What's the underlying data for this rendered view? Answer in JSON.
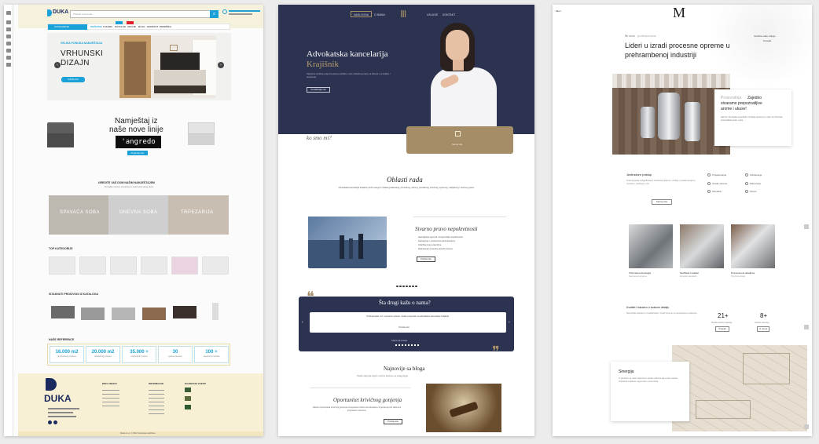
{
  "duka": {
    "logo": "DUKA",
    "search_placeholder": "Pretraži proizvode...",
    "nav": {
      "categories": "KATEGORIJE",
      "items": [
        "POČETNA",
        "O NAMA",
        "KATALOG",
        "AKCIJE",
        "BLOG",
        "KONTAKT",
        "PODRŠKA"
      ]
    },
    "hero": {
      "kicker": "VELIKA PONUDA NAMJEŠTAJA",
      "title1": "VRHUNSKI",
      "title2": "DIZAJN",
      "button": "KATALOG"
    },
    "promo": {
      "line1": "Namještaj iz",
      "line2": "naše nove linije",
      "brand": "'angredo",
      "button": "Pogledaj više"
    },
    "rooms": {
      "title": "UREDITE VAŠ DOM NAŠIM NAMJEŠTAJEM",
      "subtitle": "Pronađite savršen namještaj za svaki kutak vašeg doma",
      "labels": [
        "SPAVAĆA SOBA",
        "DNEVNA SOBA",
        "TRPEZARIJA"
      ]
    },
    "top_categories": "TOP KATEGORIJE",
    "featured": "ISTAKNUTI PROIZVODI IZ KATALOGA",
    "references": {
      "title": "NAŠE REFERENCE",
      "stats": [
        {
          "value": "16.000 m2",
          "label": "proizvodnog prostora"
        },
        {
          "value": "20.000 m2",
          "label": "skladišnog prostora"
        },
        {
          "value": "35.000 +",
          "label": "zadovoljnih kupaca"
        },
        {
          "value": "30",
          "label": "godina iskustva"
        },
        {
          "value": "100 +",
          "label": "zaposlenih radnika"
        }
      ]
    },
    "footer": {
      "col1": "BRZI LINKOVI",
      "col2": "INFORMACIJE",
      "col3": "NAJNOVIJE VIJESTI",
      "copyright": "Duka d.o.o. © 2021 Sva prava zadržana"
    }
  },
  "law": {
    "nav": [
      "NASLOVNA",
      "O NAMA",
      "USLUGE",
      "KONTAKT"
    ],
    "hero": {
      "title": "Advokatska kancelarija",
      "name": "Krajišnik",
      "text": "Klijentima pružamo potpunu pravnu podršku u svim oblastima prava, sa fokusom na kvalitet i povjerenje.",
      "button": "Kontaktirajte nas"
    },
    "about_fragment": "ko smo mi?",
    "gold_text": "Saznaj više",
    "areas": {
      "title": "Oblasti rada",
      "text": "Advokatska kancelarija Krajišnik pruža usluge iz oblasti građanskog, privrednog, radnog, porodičnog, krivičnog, upravnog, nasljednog i stvarnog prava."
    },
    "feature": {
      "title": "Stvarno pravo nepokretnosti",
      "bullets": [
        "Sastavljanje ugovora o kupoprodaji nepokretnosti",
        "Zastupanje u postupcima pred katastrom",
        "Uknjižba prava vlasništva",
        "Rješavanje imovinsko-pravnih odnosa"
      ],
      "button": "Pročitaj više"
    },
    "testimonials": {
      "title": "Šta drugi kažu o nama?",
      "quote": "Profesionalan, brz i posvećen pristup. Svaku preporuku za advokatsku kancelariju Krajišnik.",
      "more": "Pročitaj više",
      "author": "Klijent kancelarije"
    },
    "blog": {
      "title": "Najnovije sa bloga",
      "subtitle": "Pratite najnovije vijesti i stručne tekstove sa našeg bloga",
      "post_title": "Oportunitet krivičnog gonjenja",
      "post_text": "Načelo oportuniteta krivičnog gonjenja omogućava tužiocu da odustane od gonjenja pod zakonom propisanim uslovima.",
      "button": "Pročitaj više"
    }
  },
  "mco": {
    "logo": "M",
    "menu": "Meni",
    "hero": {
      "kicker": "Mi smo",
      "kicker2": "profesionalne",
      "title1": "Lideri u izradi procesne opreme u",
      "title2": "prehrambenoj industriji",
      "side1": "Istražite naše usluge",
      "side2": "Kontakt"
    },
    "card1": {
      "title1": "Proizvodnja",
      "title2": " Zajedno",
      "title3": "stvaramo prepoznatljive",
      "title4": "arome i ukuse!",
      "text": "Naš tim stručnjaka projektuje i izrađuje opremu po mjeri za vrhunske proizvođače hrane i pića."
    },
    "custom": {
      "title": "Jedinstven pristup",
      "text": "Svaki projekat prilagođavamo potrebama klijenta, od ideje i projektovanja do montaže i puštanja u rad.",
      "button": "Saznaj više"
    },
    "icons": [
      "Projektovanje",
      "Izrada opreme",
      "Montaža",
      "Održavanje",
      "Pakovanje",
      "Servis"
    ],
    "gallery": [
      {
        "title": "Vrhunska tehnologija",
        "text": "Savremena oprema"
      },
      {
        "title": "Sertifikati i kvalitet",
        "text": "Evropski standardi"
      },
      {
        "title": "Posvećenost detaljima",
        "text": "Precizna izrada"
      }
    ],
    "quality": {
      "title": "Kvalitet i iskustvo u svakom detalju",
      "text": "Decenijsko iskustvo u projektovanju i izradi opreme za prehrambenu industriju.",
      "stats": [
        {
          "value": "21+",
          "label": "Realizovanih projekata",
          "button": "Projekti"
        },
        {
          "value": "8+",
          "label": "Godina iskustva",
          "button": "O nama"
        }
      ]
    },
    "synergy": {
      "title": "Sinergija",
      "text": "Iz saradnje sa našim klijentima nastaju rješenja koja prate najviše standarde kvaliteta i sigurnosti u proizvodnji."
    }
  }
}
